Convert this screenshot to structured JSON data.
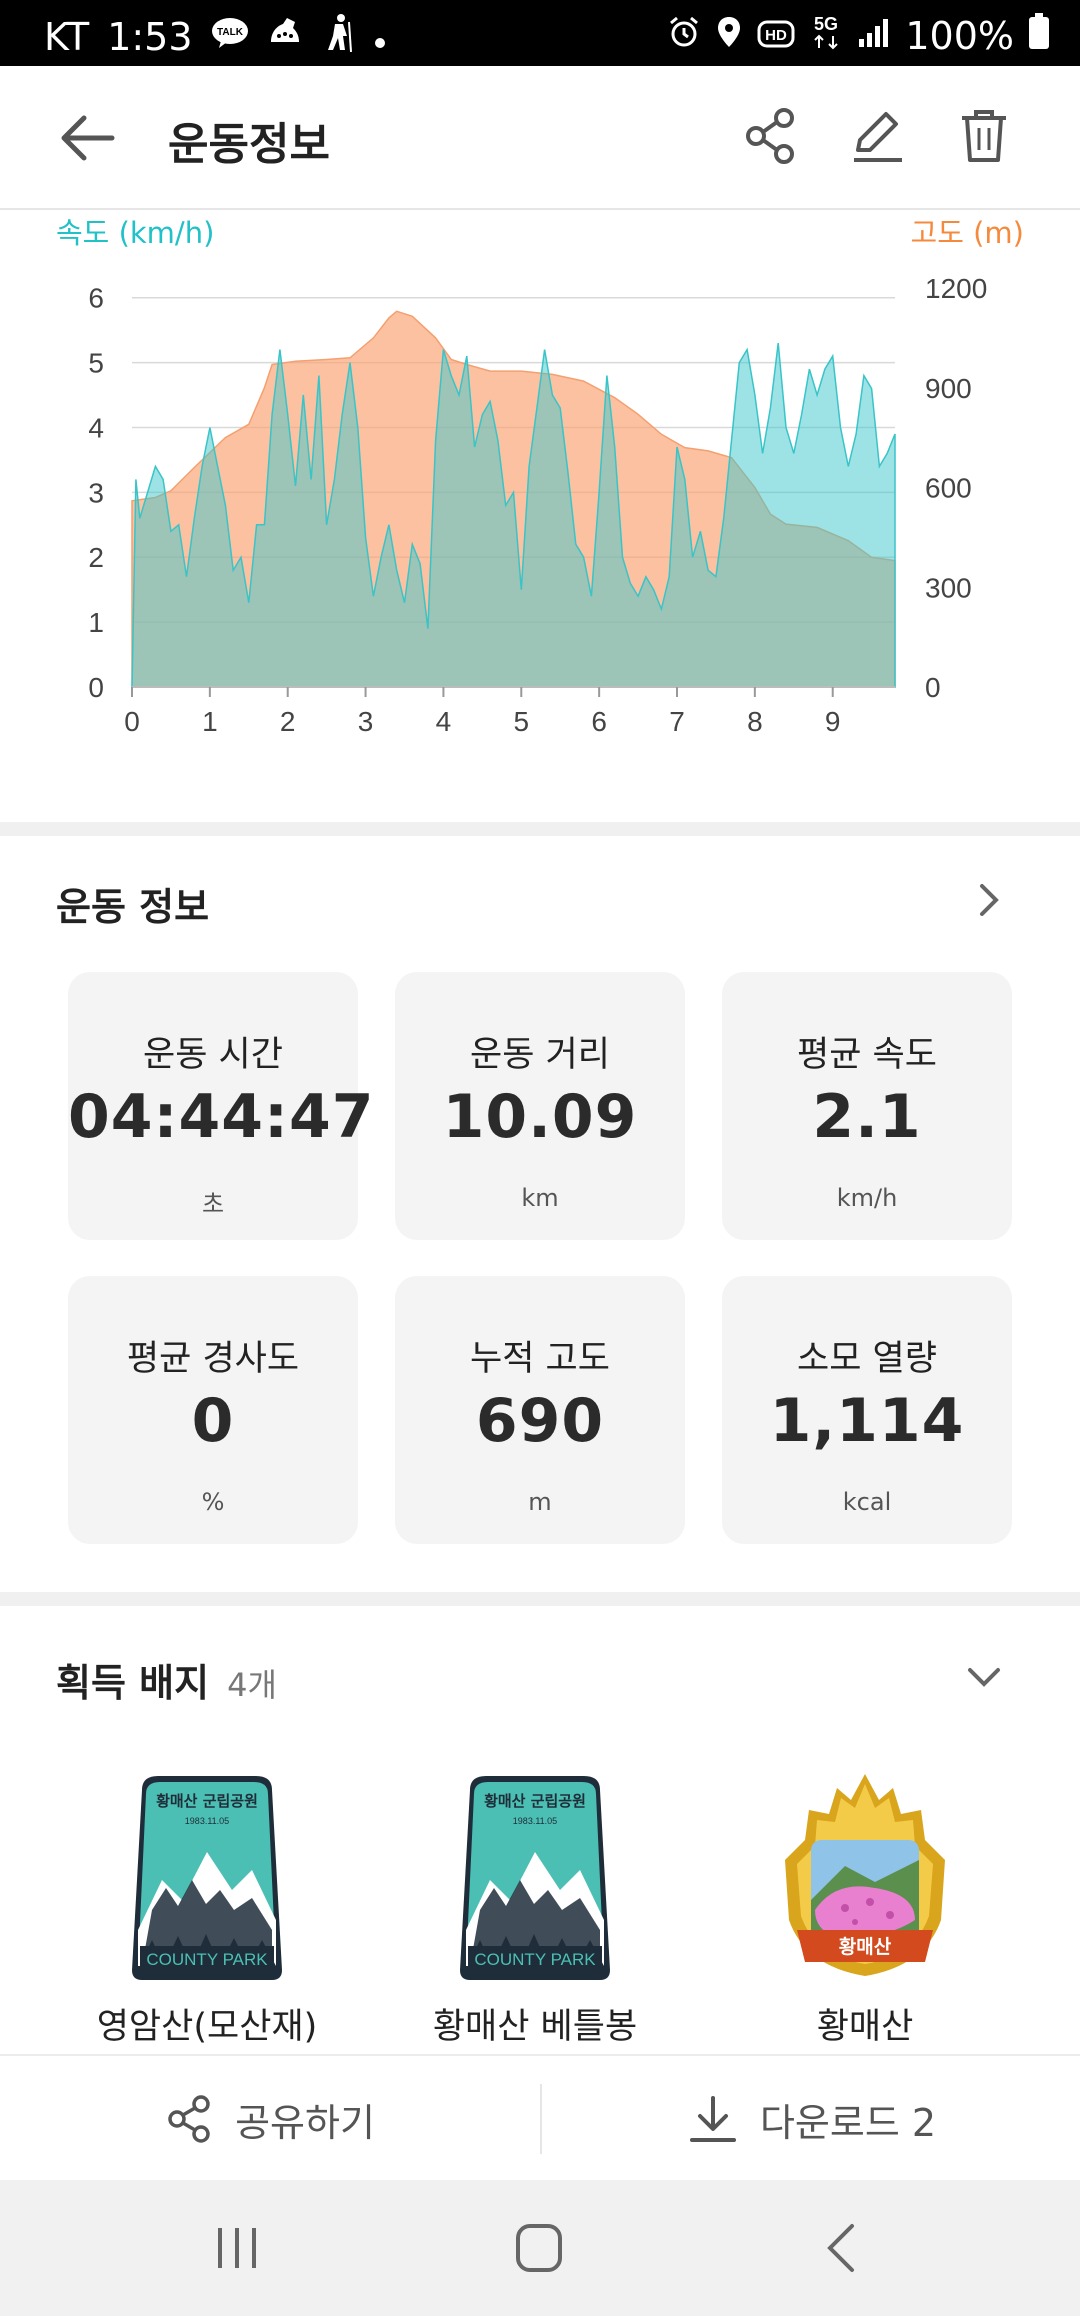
{
  "status_bar": {
    "carrier": "KT",
    "time": "1:53",
    "battery": "100%",
    "left_icons": [
      "talk-icon",
      "sneaker-icon",
      "hiker-icon",
      "dot-icon"
    ],
    "right_icons": [
      "alarm-icon",
      "location-icon",
      "hd-icon",
      "5g-icon",
      "signal-icon",
      "battery-icon"
    ]
  },
  "header": {
    "title": "운동정보",
    "actions": [
      "share-icon",
      "edit-icon",
      "delete-icon"
    ]
  },
  "chart_data": {
    "type": "area",
    "left_axis_label": "속도 (km/h)",
    "right_axis_label": "고도 (m)",
    "left_color": "#21c1c8",
    "right_color": "#f58a3c",
    "x_ticks": [
      0,
      1,
      2,
      3,
      4,
      5,
      6,
      7,
      8,
      9
    ],
    "y_left_ticks": [
      0,
      1,
      2,
      3,
      4,
      5,
      6
    ],
    "y_right_ticks": [
      0,
      300,
      600,
      900,
      1200
    ],
    "xlim": [
      0,
      9.8
    ],
    "ylim_left": [
      0,
      6.15
    ],
    "ylim_right": [
      0,
      1200
    ],
    "series": [
      {
        "name": "고도",
        "axis": "right",
        "x": [
          0,
          0.3,
          0.5,
          0.8,
          1.2,
          1.5,
          1.7,
          1.8,
          2.1,
          2.5,
          2.8,
          3.1,
          3.3,
          3.4,
          3.6,
          3.9,
          4.1,
          4.3,
          4.6,
          5.0,
          5.4,
          5.8,
          6.2,
          6.5,
          6.8,
          7.1,
          7.4,
          7.7,
          8.0,
          8.2,
          8.4,
          8.8,
          9.2,
          9.5,
          9.8
        ],
        "y": [
          560,
          570,
          590,
          660,
          750,
          790,
          900,
          970,
          980,
          985,
          990,
          1050,
          1110,
          1130,
          1115,
          1050,
          985,
          970,
          950,
          950,
          940,
          920,
          870,
          820,
          760,
          720,
          710,
          690,
          600,
          520,
          490,
          480,
          440,
          390,
          380
        ]
      },
      {
        "name": "속도",
        "axis": "left",
        "x": [
          0,
          0.05,
          0.1,
          0.2,
          0.3,
          0.4,
          0.5,
          0.6,
          0.7,
          0.8,
          0.9,
          1.0,
          1.1,
          1.2,
          1.3,
          1.4,
          1.5,
          1.6,
          1.7,
          1.8,
          1.9,
          2.0,
          2.1,
          2.2,
          2.3,
          2.4,
          2.5,
          2.6,
          2.7,
          2.8,
          2.9,
          3.0,
          3.1,
          3.2,
          3.3,
          3.4,
          3.5,
          3.6,
          3.7,
          3.8,
          3.9,
          4.0,
          4.1,
          4.2,
          4.3,
          4.4,
          4.5,
          4.6,
          4.7,
          4.8,
          4.9,
          5.0,
          5.1,
          5.2,
          5.3,
          5.4,
          5.5,
          5.6,
          5.7,
          5.8,
          5.9,
          6.0,
          6.1,
          6.2,
          6.3,
          6.4,
          6.5,
          6.6,
          6.7,
          6.8,
          6.9,
          7.0,
          7.1,
          7.2,
          7.3,
          7.4,
          7.5,
          7.6,
          7.7,
          7.8,
          7.9,
          8.0,
          8.1,
          8.2,
          8.3,
          8.4,
          8.5,
          8.6,
          8.7,
          8.8,
          8.9,
          9.0,
          9.1,
          9.2,
          9.3,
          9.4,
          9.5,
          9.6,
          9.7,
          9.8
        ],
        "y": [
          0,
          3.2,
          2.6,
          3.0,
          3.4,
          3.2,
          2.4,
          2.5,
          1.7,
          2.6,
          3.4,
          4.0,
          3.4,
          2.8,
          1.8,
          2.0,
          1.3,
          2.5,
          2.5,
          4.2,
          5.2,
          4.2,
          3.1,
          4.5,
          3.2,
          4.8,
          2.5,
          3.2,
          4.2,
          5.0,
          4.0,
          2.3,
          1.4,
          2.0,
          2.5,
          1.8,
          1.3,
          2.2,
          1.9,
          0.9,
          3.8,
          5.2,
          4.8,
          4.5,
          5.1,
          3.7,
          4.2,
          4.4,
          3.8,
          2.8,
          3.0,
          1.5,
          3.4,
          4.3,
          5.2,
          4.5,
          4.3,
          3.3,
          2.2,
          2.0,
          1.4,
          3.0,
          4.8,
          3.7,
          2.0,
          1.6,
          1.4,
          1.7,
          1.5,
          1.2,
          1.7,
          3.7,
          3.2,
          2.0,
          2.4,
          1.8,
          1.7,
          2.6,
          3.8,
          5.0,
          5.2,
          4.5,
          3.6,
          4.3,
          5.3,
          4.0,
          3.6,
          4.2,
          4.9,
          4.5,
          4.9,
          5.1,
          4.0,
          3.4,
          3.9,
          4.8,
          4.6,
          3.4,
          3.6,
          3.9
        ]
      }
    ]
  },
  "workout": {
    "title": "운동 정보",
    "cards": [
      {
        "label": "운동 시간",
        "value": "04:44:47",
        "unit": "초"
      },
      {
        "label": "운동 거리",
        "value": "10.09",
        "unit": "km"
      },
      {
        "label": "평균 속도",
        "value": "2.1",
        "unit": "km/h"
      },
      {
        "label": "평균 경사도",
        "value": "0",
        "unit": "%"
      },
      {
        "label": "누적 고도",
        "value": "690",
        "unit": "m"
      },
      {
        "label": "소모 열량",
        "value": "1,114",
        "unit": "kcal"
      }
    ]
  },
  "badges": {
    "title": "획득 배지",
    "count": "4개",
    "items": [
      {
        "name": "영암산(모산재)",
        "top_text": "황매산 군립공원",
        "date_text": "1983.11.05",
        "bottom_text": "COUNTY PARK"
      },
      {
        "name": "황매산 베틀봉",
        "top_text": "황매산 군립공원",
        "date_text": "1983.11.05",
        "bottom_text": "COUNTY PARK"
      },
      {
        "name": "황매산",
        "ribbon_text": "황매산"
      }
    ]
  },
  "bottom_actions": {
    "share_label": "공유하기",
    "download_label": "다운로드 2"
  },
  "nav": {
    "buttons": [
      "recent-apps-icon",
      "home-icon",
      "back-nav-icon"
    ]
  }
}
